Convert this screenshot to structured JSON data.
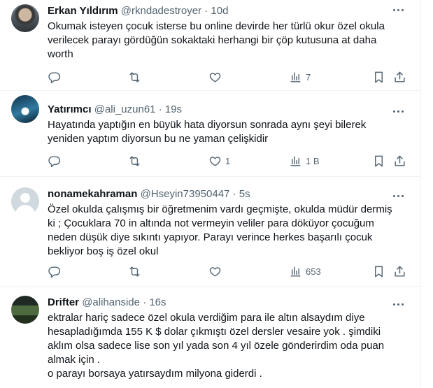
{
  "tweets": [
    {
      "name": "Erkan Yıldırım",
      "handle": "@rkndadestroyer",
      "separator": "·",
      "time": "10d",
      "lines": [
        "Okumak isteyen çocuk isterse bu online devirde her türlü okur özel okula",
        "verilecek parayı gördüğün sokaktaki herhangi bir çöp kutusuna at daha",
        "worth"
      ],
      "likes": "",
      "views": "7"
    },
    {
      "name": "Yatırımcı",
      "handle": "@ali_uzun61",
      "separator": "·",
      "time": "19s",
      "lines": [
        "Hayatında yaptığın en büyük hata diyorsun sonrada aynı şeyi bilerek",
        "yeniden yaptım diyorsun bu ne yaman çelişkidir"
      ],
      "likes": "1",
      "views": "1 B"
    },
    {
      "name": "nonamekahraman",
      "handle": "@Hseyin73950447",
      "separator": "·",
      "time": "5s",
      "lines": [
        "Özel okulda çalışmış bir öğretmenim vardı geçmişte, okulda müdür dermiş",
        "ki ; Çocuklara 70 in altında not vermeyin veliler para döküyor çocuğum",
        "neden düşük diye sıkıntı yapıyor. Parayı verince herkes başarılı çocuk",
        "bekliyor boş iş özel okul"
      ],
      "likes": "",
      "views": "653"
    },
    {
      "name": "Drifter",
      "handle": "@alihanside",
      "separator": "·",
      "time": "16s",
      "lines": [
        "ektralar hariç sadece özel okula verdiğim para ile altın alsaydım diye",
        "hesapladığımda 155 K $ dolar çıkmıştı  özel dersler vesaire yok . şimdiki",
        "aklım olsa sadece lise son yıl yada son 4 yıl özele gönderirdim oda puan",
        "almak için .",
        "o parayı borsaya yatırsaydım milyona giderdi ."
      ]
    }
  ],
  "icons": {
    "reply": "reply-icon",
    "retweet": "retweet-icon",
    "like": "heart-icon",
    "views": "views-icon",
    "bookmark": "bookmark-icon",
    "share": "share-icon",
    "more": "more-icon"
  }
}
